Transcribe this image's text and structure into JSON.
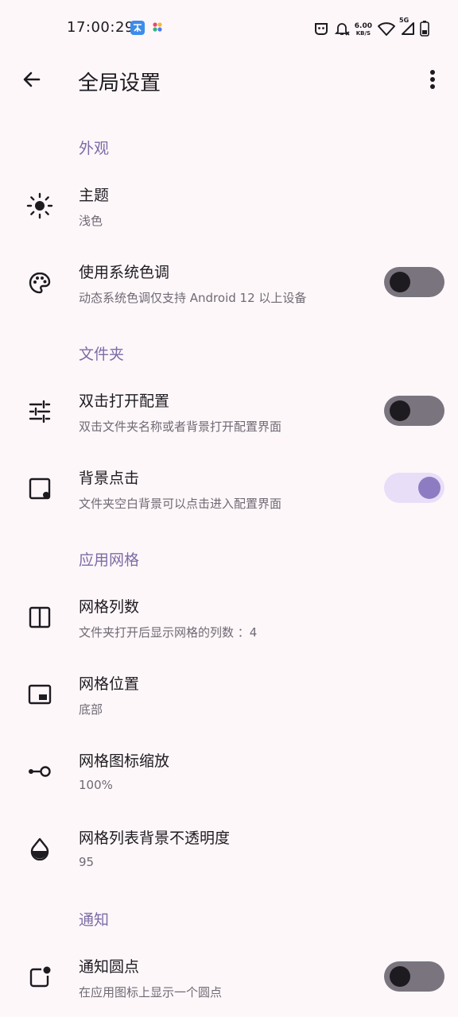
{
  "status_bar": {
    "time": "17:00:29",
    "net_speed_value": "6.00",
    "net_speed_unit": "KB/S",
    "signal_label": "5G"
  },
  "app_bar": {
    "title": "全局设置"
  },
  "sections": {
    "appearance": {
      "header": "外观",
      "theme": {
        "title": "主题",
        "subtitle": "浅色"
      },
      "system_color": {
        "title": "使用系统色调",
        "subtitle": "动态系统色调仅支持 Android 12 以上设备",
        "enabled": false
      }
    },
    "folder": {
      "header": "文件夹",
      "double_click": {
        "title": "双击打开配置",
        "subtitle": "双击文件夹名称或者背景打开配置界面",
        "enabled": false
      },
      "background_click": {
        "title": "背景点击",
        "subtitle": "文件夹空白背景可以点击进入配置界面",
        "enabled": true
      }
    },
    "app_grid": {
      "header": "应用网格",
      "columns": {
        "title": "网格列数",
        "subtitle": "文件夹打开后显示网格的列数 ：4"
      },
      "position": {
        "title": "网格位置",
        "subtitle": "底部"
      },
      "icon_scale": {
        "title": "网格图标缩放",
        "subtitle": "100%"
      },
      "bg_opacity": {
        "title": "网格列表背景不透明度",
        "subtitle": "95"
      }
    },
    "notification": {
      "header": "通知",
      "dot": {
        "title": "通知圆点",
        "subtitle": "在应用图标上显示一个圆点",
        "enabled": false
      }
    }
  },
  "colors": {
    "background": "#FEF7FA",
    "accent": "#7D6BA6",
    "toggle_on_track": "#E9DEF8",
    "toggle_on_knob": "#8E7CC3",
    "toggle_off_track": "#79747E"
  }
}
